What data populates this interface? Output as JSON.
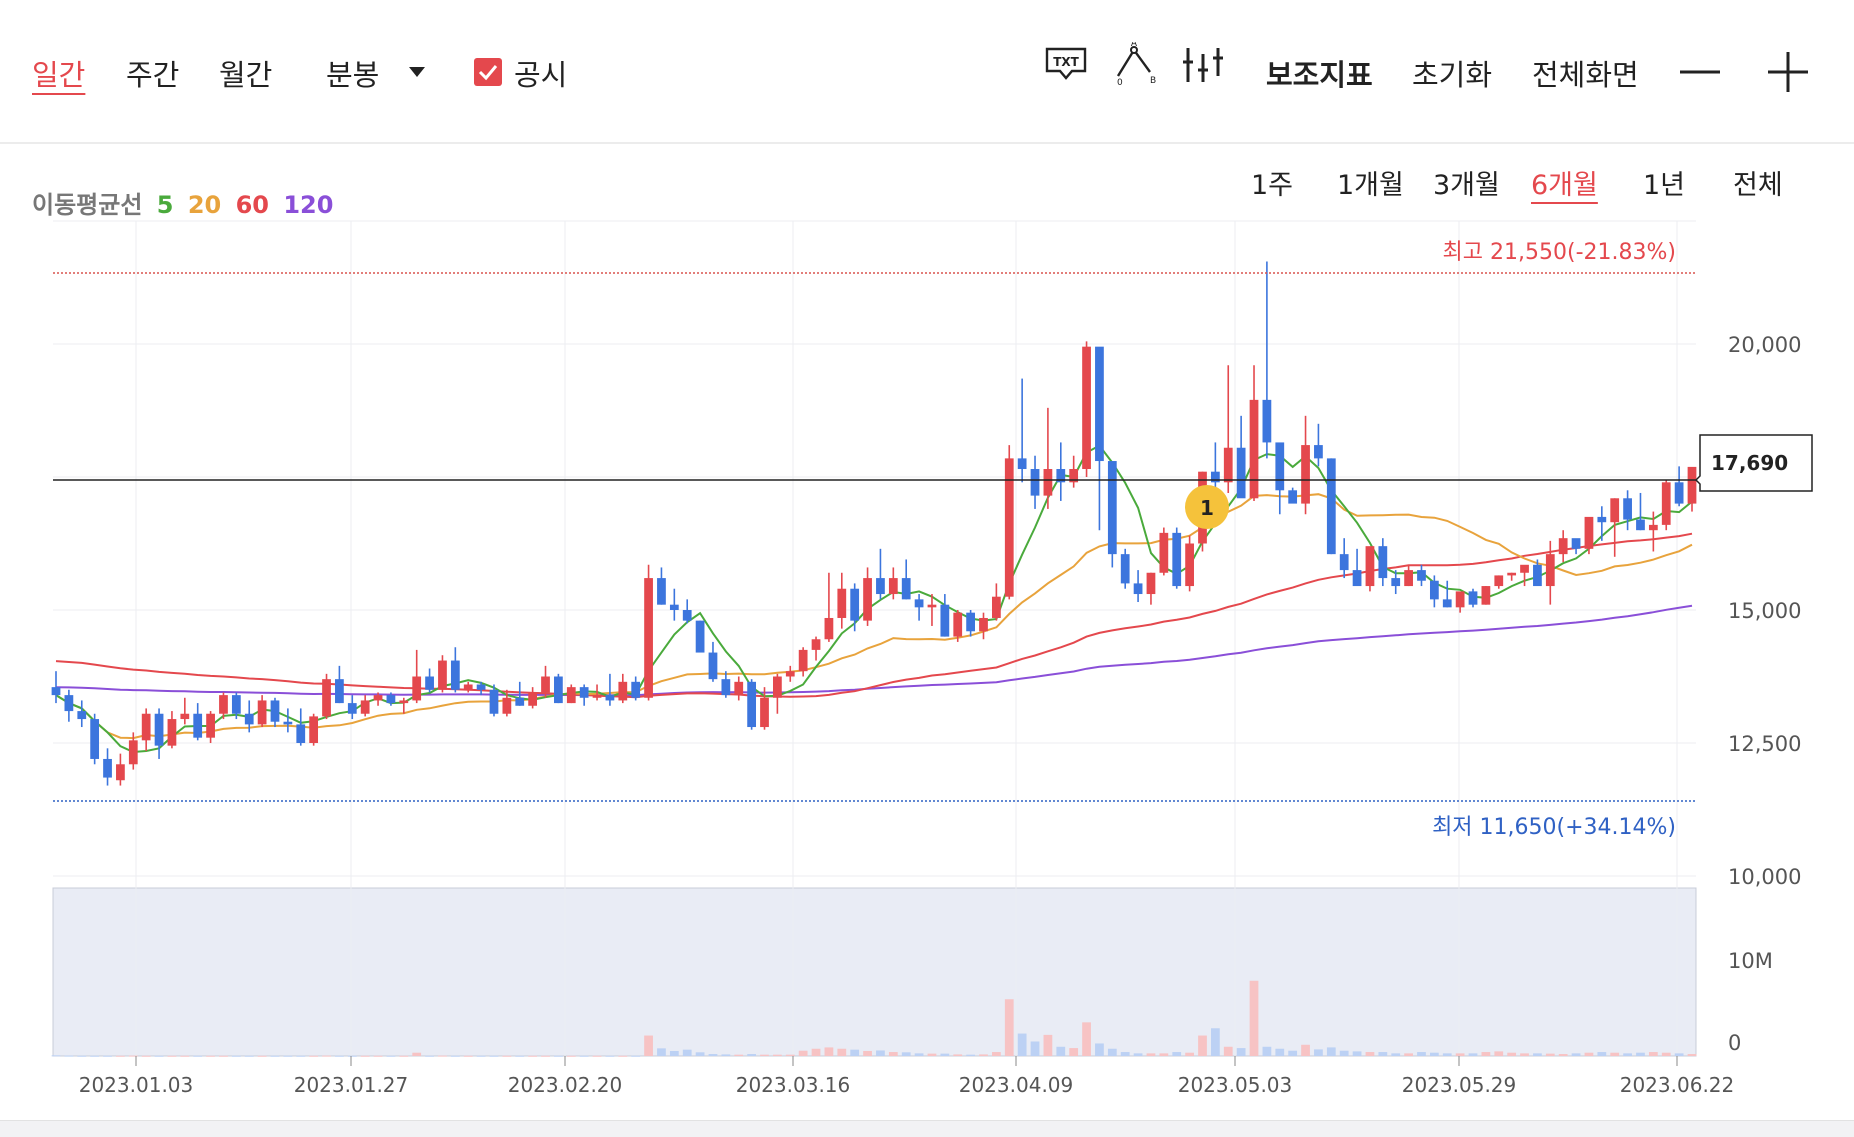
{
  "toolbar": {
    "periods": [
      "일간",
      "주간",
      "월간"
    ],
    "minute_label": "분봉",
    "disclosure_label": "공시",
    "txt_icon_label": "TXT",
    "indicator_label": "보조지표",
    "reset_label": "초기화",
    "fullscreen_label": "전체화면"
  },
  "ma_legend": {
    "label": "이동평균선",
    "p5": "5",
    "p20": "20",
    "p60": "60",
    "p120": "120"
  },
  "ranges": [
    "1주",
    "1개월",
    "3개월",
    "6개월",
    "1년",
    "전체"
  ],
  "colors": {
    "up": "#e4484d",
    "down": "#3c75dd",
    "ma5": "#4aaa3c",
    "ma20": "#e8a33c",
    "ma60": "#e4484d",
    "ma120": "#8a4fd8",
    "volume_bg": "#e9ecf5"
  },
  "chart_data": {
    "type": "candlestick",
    "price_axis": {
      "ticks": [
        "20,000",
        "15,000",
        "12,500",
        "10,000"
      ],
      "ylim": [
        10000,
        21550
      ]
    },
    "volume_axis": {
      "ticks": [
        "10M",
        "0"
      ]
    },
    "x_ticks": [
      "2023.01.03",
      "2023.01.27",
      "2023.02.20",
      "2023.03.16",
      "2023.04.09",
      "2023.05.03",
      "2023.05.29",
      "2023.06.22"
    ],
    "high_label": "최고 21,550(-21.83%)",
    "low_label": "최저 11,650(+34.14%)",
    "high": 21550,
    "low": 11650,
    "current_price": 17690,
    "current_price_label": "17,690",
    "disclosure_marker": "1",
    "candles": [
      [
        13550,
        13850,
        13250,
        13400
      ],
      [
        13400,
        13500,
        12900,
        13100
      ],
      [
        13100,
        13300,
        12800,
        12950
      ],
      [
        12950,
        13050,
        12100,
        12200
      ],
      [
        12200,
        12400,
        11700,
        11850
      ],
      [
        11800,
        12300,
        11700,
        12100
      ],
      [
        12100,
        12700,
        12000,
        12550
      ],
      [
        12550,
        13150,
        12350,
        13050
      ],
      [
        13050,
        13150,
        12200,
        12450
      ],
      [
        12450,
        13100,
        12400,
        12950
      ],
      [
        12950,
        13350,
        12850,
        13050
      ],
      [
        13050,
        13250,
        12550,
        12600
      ],
      [
        12600,
        13100,
        12500,
        13050
      ],
      [
        13050,
        13450,
        12950,
        13400
      ],
      [
        13400,
        13450,
        12950,
        13050
      ],
      [
        13050,
        13300,
        12700,
        12850
      ],
      [
        12850,
        13400,
        12800,
        13300
      ],
      [
        13300,
        13350,
        12800,
        12900
      ],
      [
        12900,
        13150,
        12700,
        12850
      ],
      [
        12850,
        13150,
        12450,
        12500
      ],
      [
        12500,
        13050,
        12450,
        13000
      ],
      [
        13000,
        13800,
        12950,
        13700
      ],
      [
        13700,
        13950,
        13250,
        13250
      ],
      [
        13250,
        13400,
        12950,
        13050
      ],
      [
        13050,
        13400,
        13000,
        13300
      ],
      [
        13300,
        13450,
        13200,
        13400
      ],
      [
        13400,
        13450,
        13200,
        13250
      ],
      [
        13250,
        13350,
        13050,
        13300
      ],
      [
        13300,
        14250,
        13250,
        13750
      ],
      [
        13750,
        13900,
        13450,
        13500
      ],
      [
        13500,
        14150,
        13450,
        14050
      ],
      [
        14050,
        14300,
        13450,
        13500
      ],
      [
        13500,
        13650,
        13450,
        13600
      ],
      [
        13600,
        13650,
        13400,
        13500
      ],
      [
        13500,
        13600,
        13000,
        13050
      ],
      [
        13050,
        13500,
        13000,
        13350
      ],
      [
        13350,
        13650,
        13200,
        13200
      ],
      [
        13200,
        13550,
        13150,
        13450
      ],
      [
        13450,
        13950,
        13350,
        13750
      ],
      [
        13750,
        13800,
        13250,
        13250
      ],
      [
        13250,
        13600,
        13250,
        13550
      ],
      [
        13550,
        13600,
        13200,
        13350
      ],
      [
        13350,
        13600,
        13300,
        13400
      ],
      [
        13400,
        13800,
        13200,
        13300
      ],
      [
        13300,
        13800,
        13250,
        13650
      ],
      [
        13650,
        13750,
        13300,
        13350
      ],
      [
        13350,
        15850,
        13300,
        15600
      ],
      [
        15600,
        15800,
        15100,
        15100
      ],
      [
        15100,
        15400,
        14800,
        15000
      ],
      [
        15000,
        15200,
        14750,
        14800
      ],
      [
        14800,
        14800,
        14300,
        14200
      ],
      [
        14200,
        14400,
        13650,
        13700
      ],
      [
        13700,
        13850,
        13350,
        13400
      ],
      [
        13400,
        13750,
        13300,
        13650
      ],
      [
        13650,
        13700,
        12750,
        12800
      ],
      [
        12800,
        13550,
        12750,
        13350
      ],
      [
        13350,
        13800,
        13050,
        13750
      ],
      [
        13750,
        13950,
        13650,
        13850
      ],
      [
        13850,
        14300,
        13750,
        14250
      ],
      [
        14250,
        14500,
        14050,
        14450
      ],
      [
        14450,
        15700,
        14400,
        14850
      ],
      [
        14850,
        15700,
        14650,
        15400
      ],
      [
        15400,
        15500,
        14600,
        14800
      ],
      [
        14800,
        15800,
        14700,
        15600
      ],
      [
        15600,
        16150,
        15200,
        15300
      ],
      [
        15300,
        15800,
        15200,
        15600
      ],
      [
        15600,
        15950,
        15200,
        15200
      ],
      [
        15200,
        15300,
        14800,
        15050
      ],
      [
        15050,
        15300,
        14700,
        15100
      ],
      [
        15100,
        15300,
        14500,
        14500
      ],
      [
        14500,
        15000,
        14400,
        14950
      ],
      [
        14950,
        15000,
        14500,
        14600
      ],
      [
        14600,
        14950,
        14450,
        14850
      ],
      [
        14850,
        15500,
        14800,
        15250
      ],
      [
        15250,
        18100,
        15200,
        17850
      ],
      [
        17850,
        19350,
        17400,
        17650
      ],
      [
        17650,
        17900,
        16900,
        17150
      ],
      [
        17150,
        18800,
        16900,
        17650
      ],
      [
        17650,
        18150,
        17050,
        17400
      ],
      [
        17400,
        17900,
        17300,
        17650
      ],
      [
        17650,
        20050,
        17500,
        19950
      ],
      [
        19950,
        19450,
        16500,
        17800
      ],
      [
        17800,
        17100,
        15800,
        16050
      ],
      [
        16050,
        16150,
        15400,
        15500
      ],
      [
        15500,
        15750,
        15150,
        15300
      ],
      [
        15300,
        15700,
        15100,
        15700
      ],
      [
        15700,
        16550,
        15650,
        16450
      ],
      [
        16450,
        16550,
        15400,
        15450
      ],
      [
        15450,
        16400,
        15350,
        16250
      ],
      [
        16250,
        17600,
        16100,
        17600
      ],
      [
        17600,
        18150,
        17200,
        17400
      ],
      [
        17400,
        19600,
        17200,
        18050
      ],
      [
        18050,
        18650,
        17600,
        17100
      ],
      [
        17100,
        19600,
        17050,
        18950
      ],
      [
        18950,
        21550,
        17850,
        18150
      ],
      [
        18150,
        18050,
        16800,
        17250
      ],
      [
        17250,
        17300,
        17100,
        17000
      ],
      [
        17000,
        18650,
        16800,
        18100
      ],
      [
        18100,
        18500,
        17700,
        17850
      ],
      [
        17850,
        17850,
        16050,
        16050
      ],
      [
        16050,
        16350,
        15600,
        15750
      ],
      [
        15750,
        16150,
        15500,
        15450
      ],
      [
        15450,
        16150,
        15350,
        16200
      ],
      [
        16200,
        16350,
        15450,
        15600
      ],
      [
        15600,
        15750,
        15300,
        15450
      ],
      [
        15450,
        15850,
        15450,
        15750
      ],
      [
        15750,
        15850,
        15450,
        15550
      ],
      [
        15550,
        15650,
        15050,
        15200
      ],
      [
        15200,
        15550,
        15050,
        15050
      ],
      [
        15050,
        15300,
        14950,
        15350
      ],
      [
        15350,
        15400,
        15050,
        15100
      ],
      [
        15100,
        15450,
        15100,
        15450
      ],
      [
        15450,
        15650,
        15400,
        15650
      ],
      [
        15650,
        15700,
        15550,
        15700
      ],
      [
        15700,
        15800,
        15450,
        15850
      ],
      [
        15850,
        15950,
        15500,
        15450
      ],
      [
        15450,
        16300,
        15100,
        16050
      ],
      [
        16050,
        16500,
        15900,
        16350
      ],
      [
        16350,
        16300,
        16050,
        16150
      ],
      [
        16150,
        16700,
        16050,
        16750
      ],
      [
        16750,
        16950,
        16300,
        16650
      ],
      [
        16650,
        17100,
        16000,
        17100
      ],
      [
        17100,
        17250,
        16500,
        16700
      ],
      [
        16700,
        17200,
        16500,
        16500
      ],
      [
        16500,
        16850,
        16100,
        16600
      ],
      [
        16600,
        17450,
        16500,
        17400
      ],
      [
        17400,
        17700,
        16950,
        17000
      ],
      [
        17000,
        17650,
        16850,
        17690
      ]
    ],
    "volume": [
      0.05,
      0.03,
      0.02,
      0.02,
      0.02,
      0.02,
      0.03,
      0.02,
      0.02,
      0.02,
      0.02,
      0.02,
      0.02,
      0.02,
      0.02,
      0.02,
      0.02,
      0.02,
      0.02,
      0.02,
      0.02,
      0.03,
      0.02,
      0.02,
      0.02,
      0.02,
      0.02,
      0.02,
      0.25,
      0.02,
      0.03,
      0.02,
      0.02,
      0.02,
      0.02,
      0.02,
      0.02,
      0.02,
      0.02,
      0.02,
      0.02,
      0.02,
      0.02,
      0.02,
      0.02,
      0.02,
      1.55,
      0.58,
      0.38,
      0.48,
      0.28,
      0.15,
      0.12,
      0.1,
      0.15,
      0.1,
      0.1,
      0.1,
      0.4,
      0.55,
      0.65,
      0.55,
      0.48,
      0.38,
      0.42,
      0.3,
      0.28,
      0.2,
      0.18,
      0.18,
      0.12,
      0.1,
      0.12,
      0.3,
      4.3,
      1.7,
      1.1,
      1.6,
      0.7,
      0.6,
      2.55,
      0.95,
      0.55,
      0.3,
      0.2,
      0.2,
      0.2,
      0.3,
      0.25,
      1.55,
      2.1,
      0.7,
      0.6,
      5.7,
      0.7,
      0.55,
      0.4,
      0.85,
      0.5,
      0.65,
      0.4,
      0.35,
      0.3,
      0.3,
      0.2,
      0.2,
      0.3,
      0.25,
      0.2,
      0.2,
      0.2,
      0.3,
      0.35,
      0.25,
      0.2,
      0.2,
      0.18,
      0.15,
      0.2,
      0.25,
      0.3,
      0.25,
      0.2,
      0.25,
      0.3,
      0.25,
      0.2,
      0.15
    ]
  }
}
